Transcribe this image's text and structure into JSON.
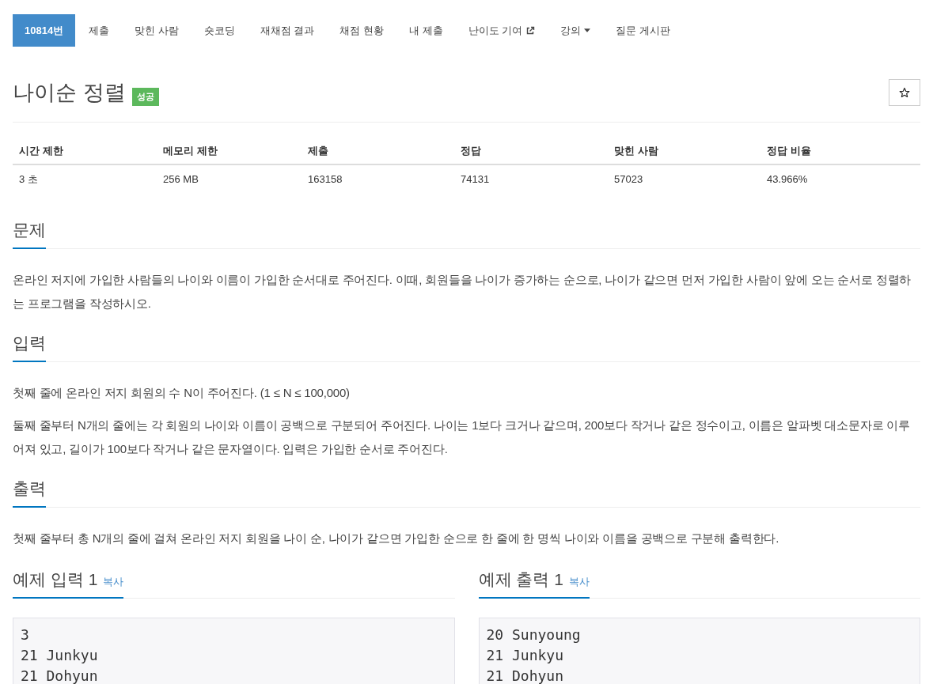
{
  "nav_tabs": [
    {
      "label": "10814번",
      "selected": true,
      "kind": "link"
    },
    {
      "label": "제출",
      "selected": false,
      "kind": "link"
    },
    {
      "label": "맞힌 사람",
      "selected": false,
      "kind": "link"
    },
    {
      "label": "숏코딩",
      "selected": false,
      "kind": "link"
    },
    {
      "label": "재채점 결과",
      "selected": false,
      "kind": "link"
    },
    {
      "label": "채점 현황",
      "selected": false,
      "kind": "link"
    },
    {
      "label": "내 제출",
      "selected": false,
      "kind": "link"
    },
    {
      "label": "난이도 기여",
      "selected": false,
      "kind": "external"
    },
    {
      "label": "강의",
      "selected": false,
      "kind": "dropdown"
    },
    {
      "label": "질문 게시판",
      "selected": false,
      "kind": "link"
    }
  ],
  "problem": {
    "title": "나이순 정렬",
    "badge": "성공"
  },
  "info_table": {
    "columns": [
      "시간 제한",
      "메모리 제한",
      "제출",
      "정답",
      "맞힌 사람",
      "정답 비율"
    ],
    "rows": [
      [
        "3 초",
        "256 MB",
        "163158",
        "74131",
        "57023",
        "43.966%"
      ]
    ]
  },
  "sections": [
    {
      "title": "문제",
      "paragraphs": [
        "온라인 저지에 가입한 사람들의 나이와 이름이 가입한 순서대로 주어진다. 이때, 회원들을 나이가 증가하는 순으로, 나이가 같으면 먼저 가입한 사람이 앞에 오는 순서로 정렬하는 프로그램을 작성하시오."
      ]
    },
    {
      "title": "입력",
      "paragraphs": [
        "첫째 줄에 온라인 저지 회원의 수 N이 주어진다. (1 ≤ N ≤ 100,000)",
        "둘째 줄부터 N개의 줄에는 각 회원의 나이와 이름이 공백으로 구분되어 주어진다. 나이는 1보다 크거나 같으며, 200보다 작거나 같은 정수이고, 이름은 알파벳 대소문자로 이루어져 있고, 길이가 100보다 작거나 같은 문자열이다. 입력은 가입한 순서로 주어진다."
      ]
    },
    {
      "title": "출력",
      "paragraphs": [
        "첫째 줄부터 총 N개의 줄에 걸쳐 온라인 저지 회원을 나이 순, 나이가 같으면 가입한 순으로 한 줄에 한 명씩 나이와 이름을 공백으로 구분해 출력한다."
      ]
    }
  ],
  "samples": [
    {
      "title": "예제 입력 1",
      "copy": "복사",
      "lines": [
        "3",
        "21 Junkyu",
        "21 Dohyun"
      ]
    },
    {
      "title": "예제 출력 1",
      "copy": "복사",
      "lines": [
        "20 Sunyoung",
        "21 Junkyu",
        "21 Dohyun"
      ]
    }
  ]
}
